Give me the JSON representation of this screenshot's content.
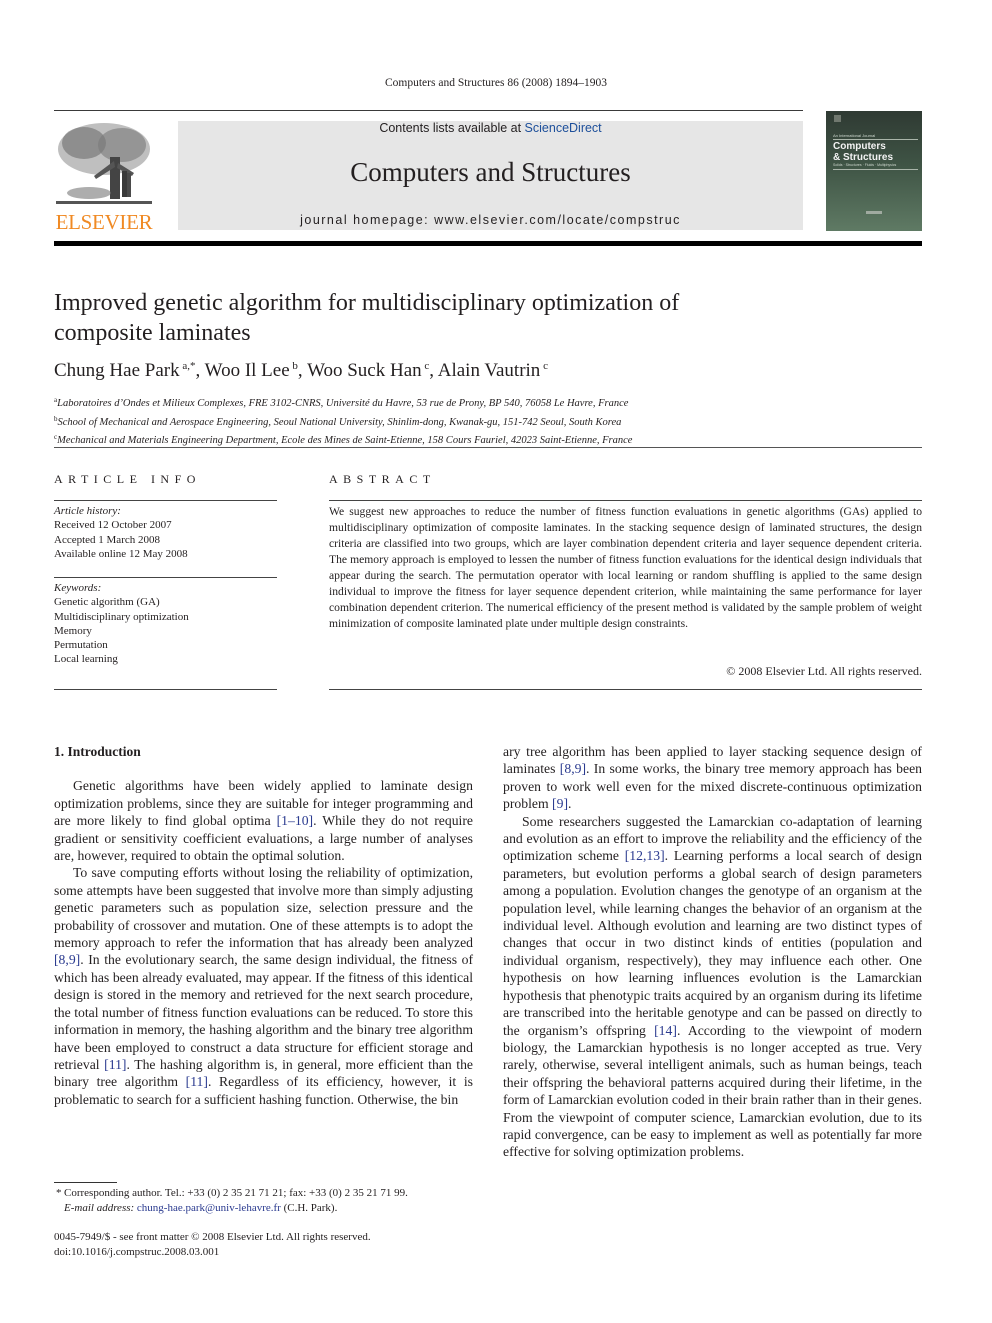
{
  "running_header": "Computers and Structures 86 (2008) 1894–1903",
  "publisher_logo": {
    "icon": "elsevier-tree-icon",
    "wordmark": "ELSEVIER",
    "color": "#f08a24"
  },
  "banner": {
    "contents_prefix": "Contents lists available at ",
    "contents_link": "ScienceDirect",
    "journal_title": "Computers and Structures",
    "homepage": "journal homepage: www.elsevier.com/locate/compstruc"
  },
  "cover": {
    "tagline": "An International Journal",
    "title_line1": "Computers",
    "title_line2": "& Structures",
    "subtitle": "Solids · Structures · Fluids · Multiphysics"
  },
  "article": {
    "title": "Improved genetic algorithm for multidisciplinary optimization of composite laminates",
    "authors": [
      {
        "name": "Chung Hae Park",
        "sup": "a,*",
        "sep": ", "
      },
      {
        "name": "Woo Il Lee",
        "sup": "b",
        "sep": ", "
      },
      {
        "name": "Woo Suck Han",
        "sup": "c",
        "sep": ", "
      },
      {
        "name": "Alain Vautrin",
        "sup": "c",
        "sep": ""
      }
    ],
    "affiliations": [
      {
        "mark": "a",
        "text": "Laboratoires d’Ondes et Milieux Complexes, FRE 3102-CNRS, Université du Havre, 53 rue de Prony, BP 540, 76058 Le Havre, France"
      },
      {
        "mark": "b",
        "text": "School of Mechanical and Aerospace Engineering, Seoul National University, Shinlim-dong, Kwanak-gu, 151-742 Seoul, South Korea"
      },
      {
        "mark": "c",
        "text": "Mechanical and Materials Engineering Department, Ecole des Mines de Saint-Etienne, 158 Cours Fauriel, 42023 Saint-Etienne, France"
      }
    ]
  },
  "article_info": {
    "heading": "ARTICLE INFO",
    "history_label": "Article history:",
    "history": [
      "Received 12 October 2007",
      "Accepted 1 March 2008",
      "Available online 12 May 2008"
    ],
    "keywords_label": "Keywords:",
    "keywords": [
      "Genetic algorithm (GA)",
      "Multidisciplinary optimization",
      "Memory",
      "Permutation",
      "Local learning"
    ]
  },
  "abstract": {
    "heading": "ABSTRACT",
    "text": "We suggest new approaches to reduce the number of fitness function evaluations in genetic algorithms (GAs) applied to multidisciplinary optimization of composite laminates. In the stacking sequence design of laminated structures, the design criteria are classified into two groups, which are layer combination dependent criteria and layer sequence dependent criteria. The memory approach is employed to lessen the number of fitness function evaluations for the identical design individuals that appear during the search. The permutation operator with local learning or random shuffling is applied to the same design individual to improve the fitness for layer sequence dependent criterion, while maintaining the same per­formance for layer combination dependent criterion. The numerical efficiency of the present method is validated by the sample problem of weight minimization of composite laminated plate under multiple design constraints.",
    "copyright": "© 2008 Elsevier Ltd. All rights reserved."
  },
  "introduction": {
    "heading": "1.  Introduction",
    "left_column": [
      [
        {
          "t": "Genetic algorithms have been widely applied to laminate design optimization problems, since they are suitable for integer pro­gramming and are more likely to find global optima "
        },
        {
          "ref": "[1–10]"
        },
        {
          "t": ". While they do not require gradient or sensitivity coefficient evaluations, a large number of analyses are, however, required to obtain the opti­mal solution."
        }
      ],
      [
        {
          "t": "To save computing efforts without losing the reliability of opti­mization, some attempts have been suggested that involve more than simply adjusting genetic parameters such as population size, selection pressure and the probability of crossover and mutation. One of these attempts is to adopt the memory approach to refer the information that has already been analyzed "
        },
        {
          "ref": "[8,9]"
        },
        {
          "t": ". In the evolu­tionary search, the same design individual, the fitness of which has been already evaluated, may appear. If the fitness of this identical design is stored in the memory and retrieved for the next search procedure, the total number of fitness function evaluations can be reduced. To store this information in memory, the hashing algo­rithm and the binary tree algorithm have been employed to con­struct a data structure for efficient storage and retrieval "
        },
        {
          "ref": "[11]"
        },
        {
          "t": ". The hashing algorithm is, in general, more efficient than the binary tree algorithm "
        },
        {
          "ref": "[11]"
        },
        {
          "t": ". Regardless of its efficiency, however, it is problem­atic to search for a sufficient hashing function. Otherwise, the bin­"
        }
      ]
    ],
    "right_column": [
      [
        {
          "t": "ary tree algorithm has been applied to layer stacking sequence design of laminates "
        },
        {
          "ref": "[8,9]"
        },
        {
          "t": ". In some works, the binary tree memory approach has been proven to work well even for the mixed dis­crete-continuous optimization problem "
        },
        {
          "ref": "[9]"
        },
        {
          "t": "."
        }
      ],
      [
        {
          "t": "Some researchers suggested the Lamarckian co-adaptation of learning and evolution as an effort to improve the reliability and the efficiency of the optimization scheme "
        },
        {
          "ref": "[12,13]"
        },
        {
          "t": ". Learning per­forms a local search of design parameters, but evolution performs a global search of design parameters among a population. Evolu­tion changes the genotype of an organism at the population level, while learning changes the behavior of an organism at the individ­ual level. Although evolution and learning are two distinct types of changes that occur in two distinct kinds of entities (population and individual organism, respectively), they may influence each other. One hypothesis on how learning influences evolution is the Lamarckian hypothesis that phenotypic traits acquired by an organism during its lifetime are transcribed into the heritable genotype and can be passed on directly to the organism’s offspring "
        },
        {
          "ref": "[14]"
        },
        {
          "t": ". According to the viewpoint of modern biology, the Lamarck­ian hypothesis is no longer accepted as true. Very rarely, otherwise, several intelligent animals, such as human beings, teach their off­spring the behavioral patterns acquired during their lifetime, in the form of Lamarckian evolution coded in their brain rather than in their genes. From the viewpoint of computer science, Lamarck­ian evolution, due to its rapid convergence, can be easy to implement as well as potentially far more effective for solving optimization problems."
        }
      ]
    ]
  },
  "footnote": {
    "star": "*",
    "corresponding": "Corresponding author. Tel.: +33 (0) 2 35 21 71 21; fax: +33 (0) 2 35 21 71 99.",
    "email_label": "E-mail address:",
    "email": "chung-hae.park@univ-lehavre.fr",
    "email_suffix": " (C.H. Park)."
  },
  "front_matter": {
    "issn_line": "0045-7949/$ - see front matter © 2008 Elsevier Ltd. All rights reserved.",
    "doi": "doi:10.1016/j.compstruc.2008.03.001"
  },
  "colors": {
    "link": "#2a3a8f",
    "sciencedirect": "#1d4f9a",
    "elsevier_orange": "#f08a24",
    "banner_bg": "#e6e6e6"
  }
}
